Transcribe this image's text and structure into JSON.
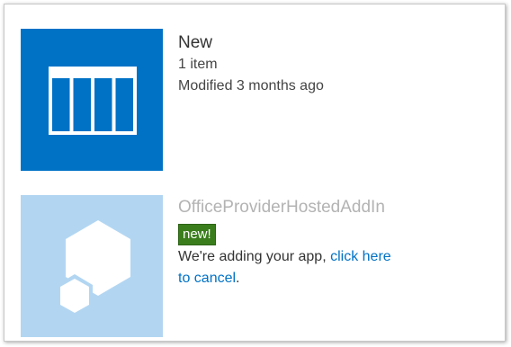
{
  "list_item": {
    "title": "New",
    "count": "1 item",
    "modified": "Modified 3 months ago",
    "icon": "list-table-icon",
    "tile_color": "#0072c6"
  },
  "app_item": {
    "title": "OfficeProviderHostedAddIn",
    "badge": "new!",
    "status_text": "We're adding your app, ",
    "cancel_link_line1": "click here",
    "cancel_link_line2": "to cancel",
    "status_end": ".",
    "icon": "app-hexagon-icon",
    "tile_color": "#b2d6f2",
    "badge_color": "#3a7d1d",
    "link_color": "#0072c6"
  }
}
